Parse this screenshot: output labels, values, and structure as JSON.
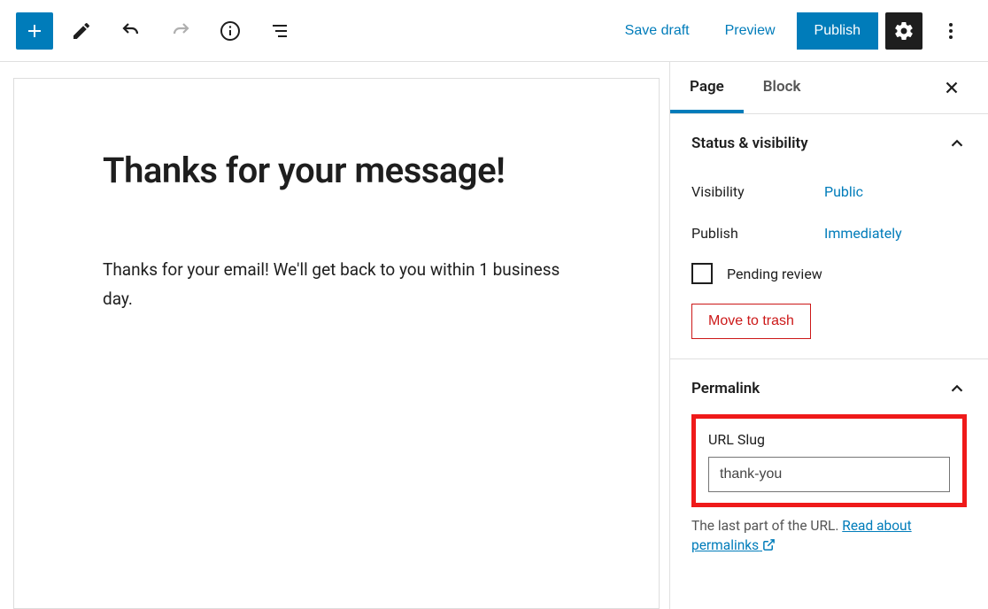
{
  "toolbar": {
    "save_draft": "Save draft",
    "preview": "Preview",
    "publish": "Publish"
  },
  "content": {
    "title": "Thanks for your message!",
    "body": "Thanks for your email! We'll get back to you within 1 business day."
  },
  "sidebar": {
    "tabs": {
      "page": "Page",
      "block": "Block"
    },
    "status_visibility": {
      "title": "Status & visibility",
      "visibility_label": "Visibility",
      "visibility_value": "Public",
      "publish_label": "Publish",
      "publish_value": "Immediately",
      "pending_review_label": "Pending review",
      "trash_label": "Move to trash"
    },
    "permalink": {
      "title": "Permalink",
      "slug_label": "URL Slug",
      "slug_value": "thank-you",
      "help_prefix": "The last part of the URL. ",
      "help_link": "Read about permalinks"
    }
  }
}
